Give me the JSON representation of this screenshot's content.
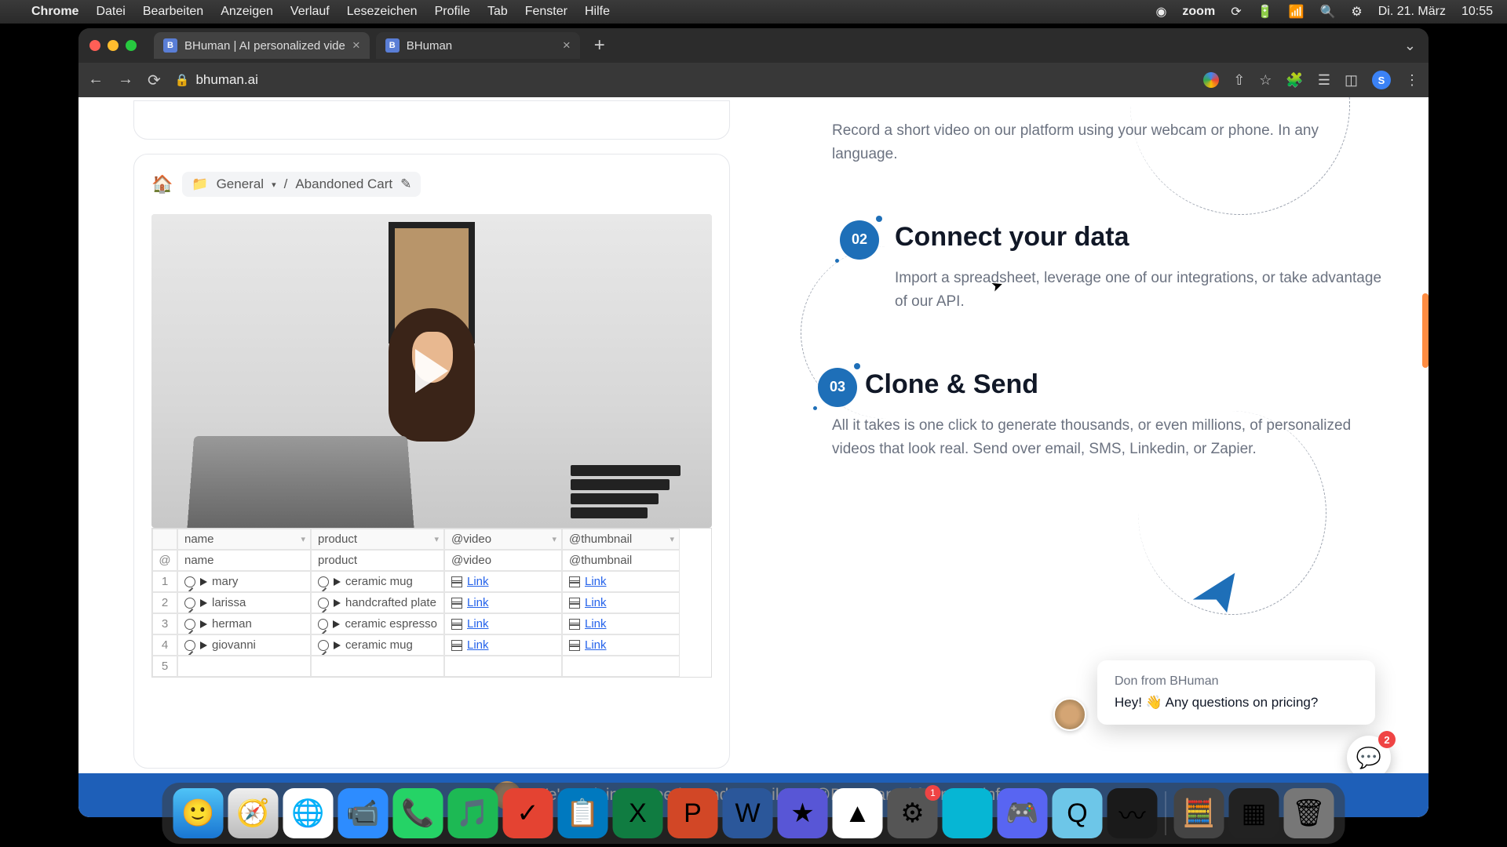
{
  "menubar": {
    "app": "Chrome",
    "items": [
      "Datei",
      "Bearbeiten",
      "Anzeigen",
      "Verlauf",
      "Lesezeichen",
      "Profile",
      "Tab",
      "Fenster",
      "Hilfe"
    ],
    "right": {
      "zoom": "zoom",
      "date": "Di. 21. März",
      "time": "10:55"
    }
  },
  "tabs": [
    {
      "title": "BHuman | AI personalized vide",
      "active": true
    },
    {
      "title": "BHuman",
      "active": false
    }
  ],
  "url": "bhuman.ai",
  "breadcrumb": {
    "folder": "General",
    "page": "Abandoned Cart"
  },
  "sheet": {
    "headers": [
      "name",
      "product",
      "@video",
      "@thumbnail"
    ],
    "row0": [
      "@",
      "name",
      "product",
      "@video",
      "@thumbnail"
    ],
    "rows": [
      {
        "n": "1",
        "name": "mary",
        "product": "ceramic mug",
        "video": "Link",
        "thumb": "Link"
      },
      {
        "n": "2",
        "name": "larissa",
        "product": "handcrafted plate",
        "video": "Link",
        "thumb": "Link"
      },
      {
        "n": "3",
        "name": "herman",
        "product": "ceramic espresso",
        "video": "Link",
        "thumb": "Link"
      },
      {
        "n": "4",
        "name": "giovanni",
        "product": "ceramic mug",
        "video": "Link",
        "thumb": "Link"
      },
      {
        "n": "5",
        "name": "",
        "product": "",
        "video": "",
        "thumb": ""
      }
    ]
  },
  "steps": {
    "s1": {
      "body": "Record a short video on our platform using your webcam or phone. In any language."
    },
    "s2": {
      "num": "02",
      "title": "Connect your data",
      "body": "Import a spreadsheet, leverage one of our integrations, or take advantage of our API."
    },
    "s3": {
      "num": "03",
      "title": "Clone & Send",
      "body": "All it takes is one click to generate thousands, or even millions, of personalized videos that look real. Send over email, SMS, Linkedin, or Zapier."
    }
  },
  "chat": {
    "from": "Don from BHuman",
    "msg": "Hey! 👋 Any questions on pricing?",
    "badge": "2"
  },
  "banner": "We're raising a seed round! Email Don@BHuman.ai for more info.",
  "dock": {
    "settings_badge": "1"
  },
  "profile_initial": "S"
}
